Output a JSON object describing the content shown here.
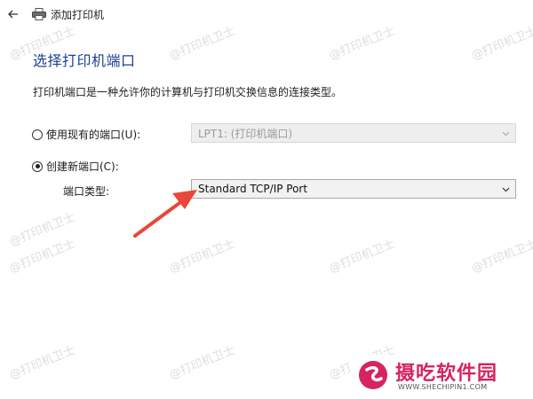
{
  "window": {
    "title": "添加打印机"
  },
  "page": {
    "heading": "选择打印机端口",
    "description": "打印机端口是一种允许你的计算机与打印机交换信息的连接类型。"
  },
  "options": {
    "use_existing": {
      "label": "使用现有的端口(U):",
      "selected": false,
      "value": "LPT1: (打印机端口)"
    },
    "create_new": {
      "label": "创建新端口(C):",
      "selected": true
    },
    "port_type": {
      "label": "端口类型:",
      "value": "Standard TCP/IP Port"
    }
  },
  "watermark": {
    "text": "@打印机卫士"
  },
  "brand": {
    "name": "摄吃软件园",
    "url": "WWW.SHECHIPIN1.COM",
    "color": "#d6245f"
  },
  "annotation": {
    "arrow_color": "#e8473a"
  }
}
